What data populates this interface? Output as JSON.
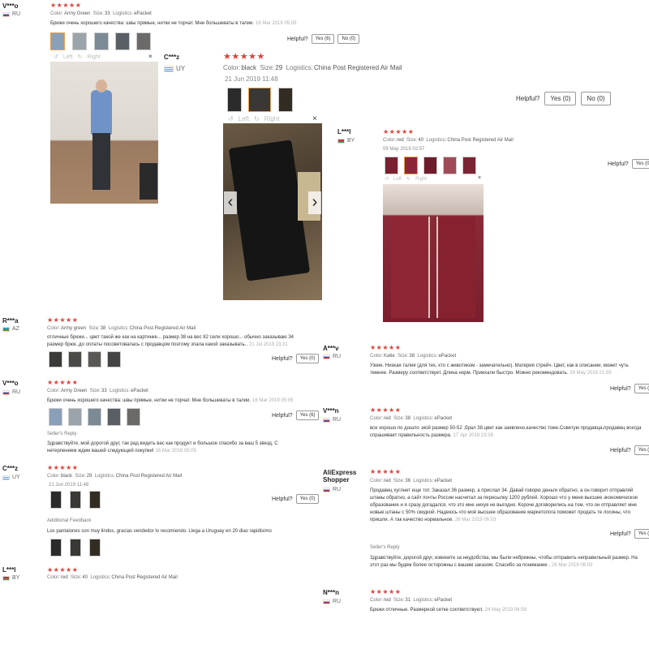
{
  "common": {
    "helpful": "Helpful?",
    "no_0": "No (0)",
    "yes_0": "Yes (0)",
    "yes_6": "Yes (6)",
    "left": "Left",
    "right": "Right",
    "close": "×",
    "prev": "‹",
    "next": "›",
    "star_count": 5,
    "star_color": "#e0403a"
  },
  "r1": {
    "user": "V***o",
    "country": "RU",
    "color_label": "Color:",
    "color": "Army Green",
    "size_label": "Size:",
    "size": "33",
    "logistics_label": "Logistics:",
    "logistics": "ePacket",
    "text": "Брюки очень хорошего качества: швы прямые, нитки не торчат. Мне большеваты в талии.",
    "date": "16 Mar 2019 05:05",
    "yes": "Yes (6)",
    "no": "No (0)"
  },
  "r2": {
    "user": "C***z",
    "country": "UY",
    "color_label": "Color:",
    "color": "black",
    "size_label": "Size:",
    "size": "29",
    "logistics_label": "Logistics:",
    "logistics": "China Post Registered Air Mail",
    "date": "21 Jun 2019 11:48",
    "yes": "Yes (0)",
    "no": "No (0)"
  },
  "r3": {
    "user": "L***l",
    "country": "BY",
    "color_label": "Color:",
    "color": "red",
    "size_label": "Size:",
    "size": "40",
    "logistics_label": "Logistics:",
    "logistics": "China Post Registered Air Mail",
    "date": "09 May 2019 02:57",
    "yes": "Yes (0"
  },
  "r4": {
    "user": "R***a",
    "country": "AZ",
    "color_label": "Color:",
    "color": "Army green",
    "size_label": "Size:",
    "size": "38",
    "logistics_label": "Logistics:",
    "logistics": "China Post Registered Air Mail",
    "text": "отличные брюки... цвет такой же как на картинке... размер 38 на вес 82 сели хорошо... обычно заказываю 34 размер брюк..до оплаты посоветовалась с продавцом поэтому зпала какой заказывать..",
    "date": "21 Jul 2019 23:31",
    "yes": "Yes (0)"
  },
  "r5": {
    "user": "A***v",
    "country": "RU",
    "color_label": "Color:",
    "color": "Katie",
    "size_label": "Size:",
    "size": "38",
    "logistics_label": "Logistics:",
    "logistics": "ePacket",
    "text": "Узкие. Низкая талия (для тех, кто с животиком - замечательно). Материя стрейч. Цвет, как в описании, может чуть темнее. Размеру соответствует. Длина норм. Приехали быстро. Можно рекомендовать.",
    "date": "29 May 2019 21:55",
    "yes": "Yes (0"
  },
  "r6": {
    "user": "V***o",
    "country": "RU",
    "color_label": "Color:",
    "color": "Army Green",
    "size_label": "Size:",
    "size": "33",
    "logistics_label": "Logistics:",
    "logistics": "ePacket",
    "text": "Брюки очень хорошего качества: швы прямые, нитки не торчат. Мне большеваты в талии.",
    "date": "16 Mar 2019 05:05",
    "yes": "Yes (6)",
    "reply_title": "Seller's Reply",
    "reply": "Здравствуйте, мой дорогой друг, так рад видеть вас как продукт и большое спасибо за ваш 5 звезд. С нетерпением ждем вашей следующей покупки!",
    "reply_date": "16 Mar 2019 05:05"
  },
  "r7": {
    "user": "V***n",
    "country": "RU",
    "color_label": "Color:",
    "color": "red",
    "size_label": "Size:",
    "size": "38",
    "logistics_label": "Logistics:",
    "logistics": "ePacket",
    "text": "все хорошо по дошло ,мой размер 50-52 ,брал 38.цвет как заявлено,качество тоже.Советую продавца,продавец всегда спрашивает правильность размера.",
    "date": "17 Apr 2019 23:38",
    "yes": "Yes (0"
  },
  "r8": {
    "user": "C***z",
    "country": "UY",
    "color_label": "Color:",
    "color": "black",
    "size_label": "Size:",
    "size": "29",
    "logistics_label": "Logistics:",
    "logistics": "China Post Registered Air Mail",
    "date": "21 Jun 2019 11:48",
    "yes": "Yes (0)",
    "additional_title": "Additional Feedback",
    "additional": "Los pantalones son muy lindos, gracias vendedor lo recomiendo. Llega a Uruguay en 20 dias rapidisimo"
  },
  "r9": {
    "user": "AliExpress Shopper",
    "country": "RU",
    "color_label": "Color:",
    "color": "red",
    "size_label": "Size:",
    "size": "36",
    "logistics_label": "Logistics:",
    "logistics": "ePacket",
    "text": "Продавец хуглнет еще тот. Заказал 36 размер, а прислал 34. Давай говорю деньги обратно, а он говорит отправляй штаны обратно, а сайт почты России насчитал за пересылку 1200 рублей. Хорошо что у меня высшее экономическое образование и я сразу догадался, что это мне нихуя не выгодно. Короче договорились на том, что он отправляет мне новые штаны с 50% скидкой. Надеюсь что моё высшее образование маркетолога поможет продать те лосины, что пришли. А так качество нормальное.",
    "date": "26 Mar 2019 06:03",
    "yes": "Yes (3",
    "reply_title": "Seller's Reply",
    "reply": "Здравствуйте, дорогой друг, извините за неудобства, мы были небрежны, чтобы отправить неправильный размер. На этот раз мы будем более осторожны с вашим заказом. Спасибо за понимание .",
    "reply_date": "26 Mar 2019 06:03"
  },
  "r10": {
    "user": "L***l",
    "country": "BY",
    "color_label": "Color:",
    "color": "red",
    "size_label": "Size:",
    "size": "40",
    "logistics_label": "Logistics:",
    "logistics": "China Post Registered Air Mail"
  },
  "r11": {
    "user": "N***n",
    "country": "RU",
    "color_label": "Color:",
    "color": "red",
    "size_label": "Size:",
    "size": "31",
    "logistics_label": "Logistics:",
    "logistics": "ePacket",
    "text": "Брюки отличные. Размерной сетке соответствуют.",
    "date": "24 May 2019 06:58"
  }
}
